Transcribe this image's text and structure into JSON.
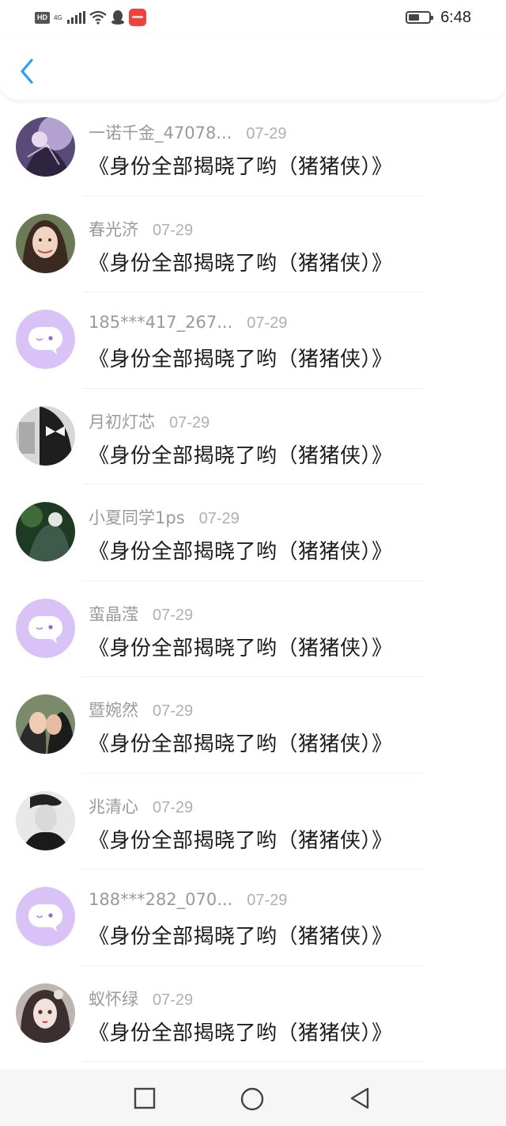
{
  "status_bar": {
    "network_badge": "HD",
    "network_type": "4G",
    "time": "6:48",
    "icons": [
      "hd-icon",
      "signal-icon",
      "wifi-icon",
      "qq-icon",
      "app-notification-icon",
      "battery-icon"
    ]
  },
  "header": {
    "back_icon": "chevron-left-icon"
  },
  "comments": [
    {
      "name": "一诺千金_47078...",
      "date": "07-29",
      "message": "《身份全部揭晓了哟（猪猪侠）》",
      "avatar": "photo"
    },
    {
      "name": "春光济",
      "date": "07-29",
      "message": "《身份全部揭晓了哟（猪猪侠）》",
      "avatar": "photo"
    },
    {
      "name": "185***417_267...",
      "date": "07-29",
      "message": "《身份全部揭晓了哟（猪猪侠）》",
      "avatar": "default-chat-bubble"
    },
    {
      "name": "月初灯芯",
      "date": "07-29",
      "message": "《身份全部揭晓了哟（猪猪侠）》",
      "avatar": "photo"
    },
    {
      "name": "小夏同学1ps",
      "date": "07-29",
      "message": "《身份全部揭晓了哟（猪猪侠）》",
      "avatar": "photo"
    },
    {
      "name": "蛮晶滢",
      "date": "07-29",
      "message": "《身份全部揭晓了哟（猪猪侠）》",
      "avatar": "default-chat-bubble"
    },
    {
      "name": "暨婉然",
      "date": "07-29",
      "message": "《身份全部揭晓了哟（猪猪侠）》",
      "avatar": "photo"
    },
    {
      "name": "兆清心",
      "date": "07-29",
      "message": "《身份全部揭晓了哟（猪猪侠）》",
      "avatar": "photo"
    },
    {
      "name": "188***282_070...",
      "date": "07-29",
      "message": "《身份全部揭晓了哟（猪猪侠）》",
      "avatar": "default-chat-bubble"
    },
    {
      "name": "蚁怀绿",
      "date": "07-29",
      "message": "《身份全部揭晓了哟（猪猪侠）》",
      "avatar": "photo"
    }
  ],
  "nav_bar": {
    "buttons": [
      "recents-square-icon",
      "home-circle-icon",
      "back-triangle-icon"
    ]
  },
  "colors": {
    "accent_blue": "#2a9df4",
    "default_avatar_bg": "#d9c2f5",
    "name_gray": "#9a9a9a",
    "message_text": "#1c1c1c"
  }
}
